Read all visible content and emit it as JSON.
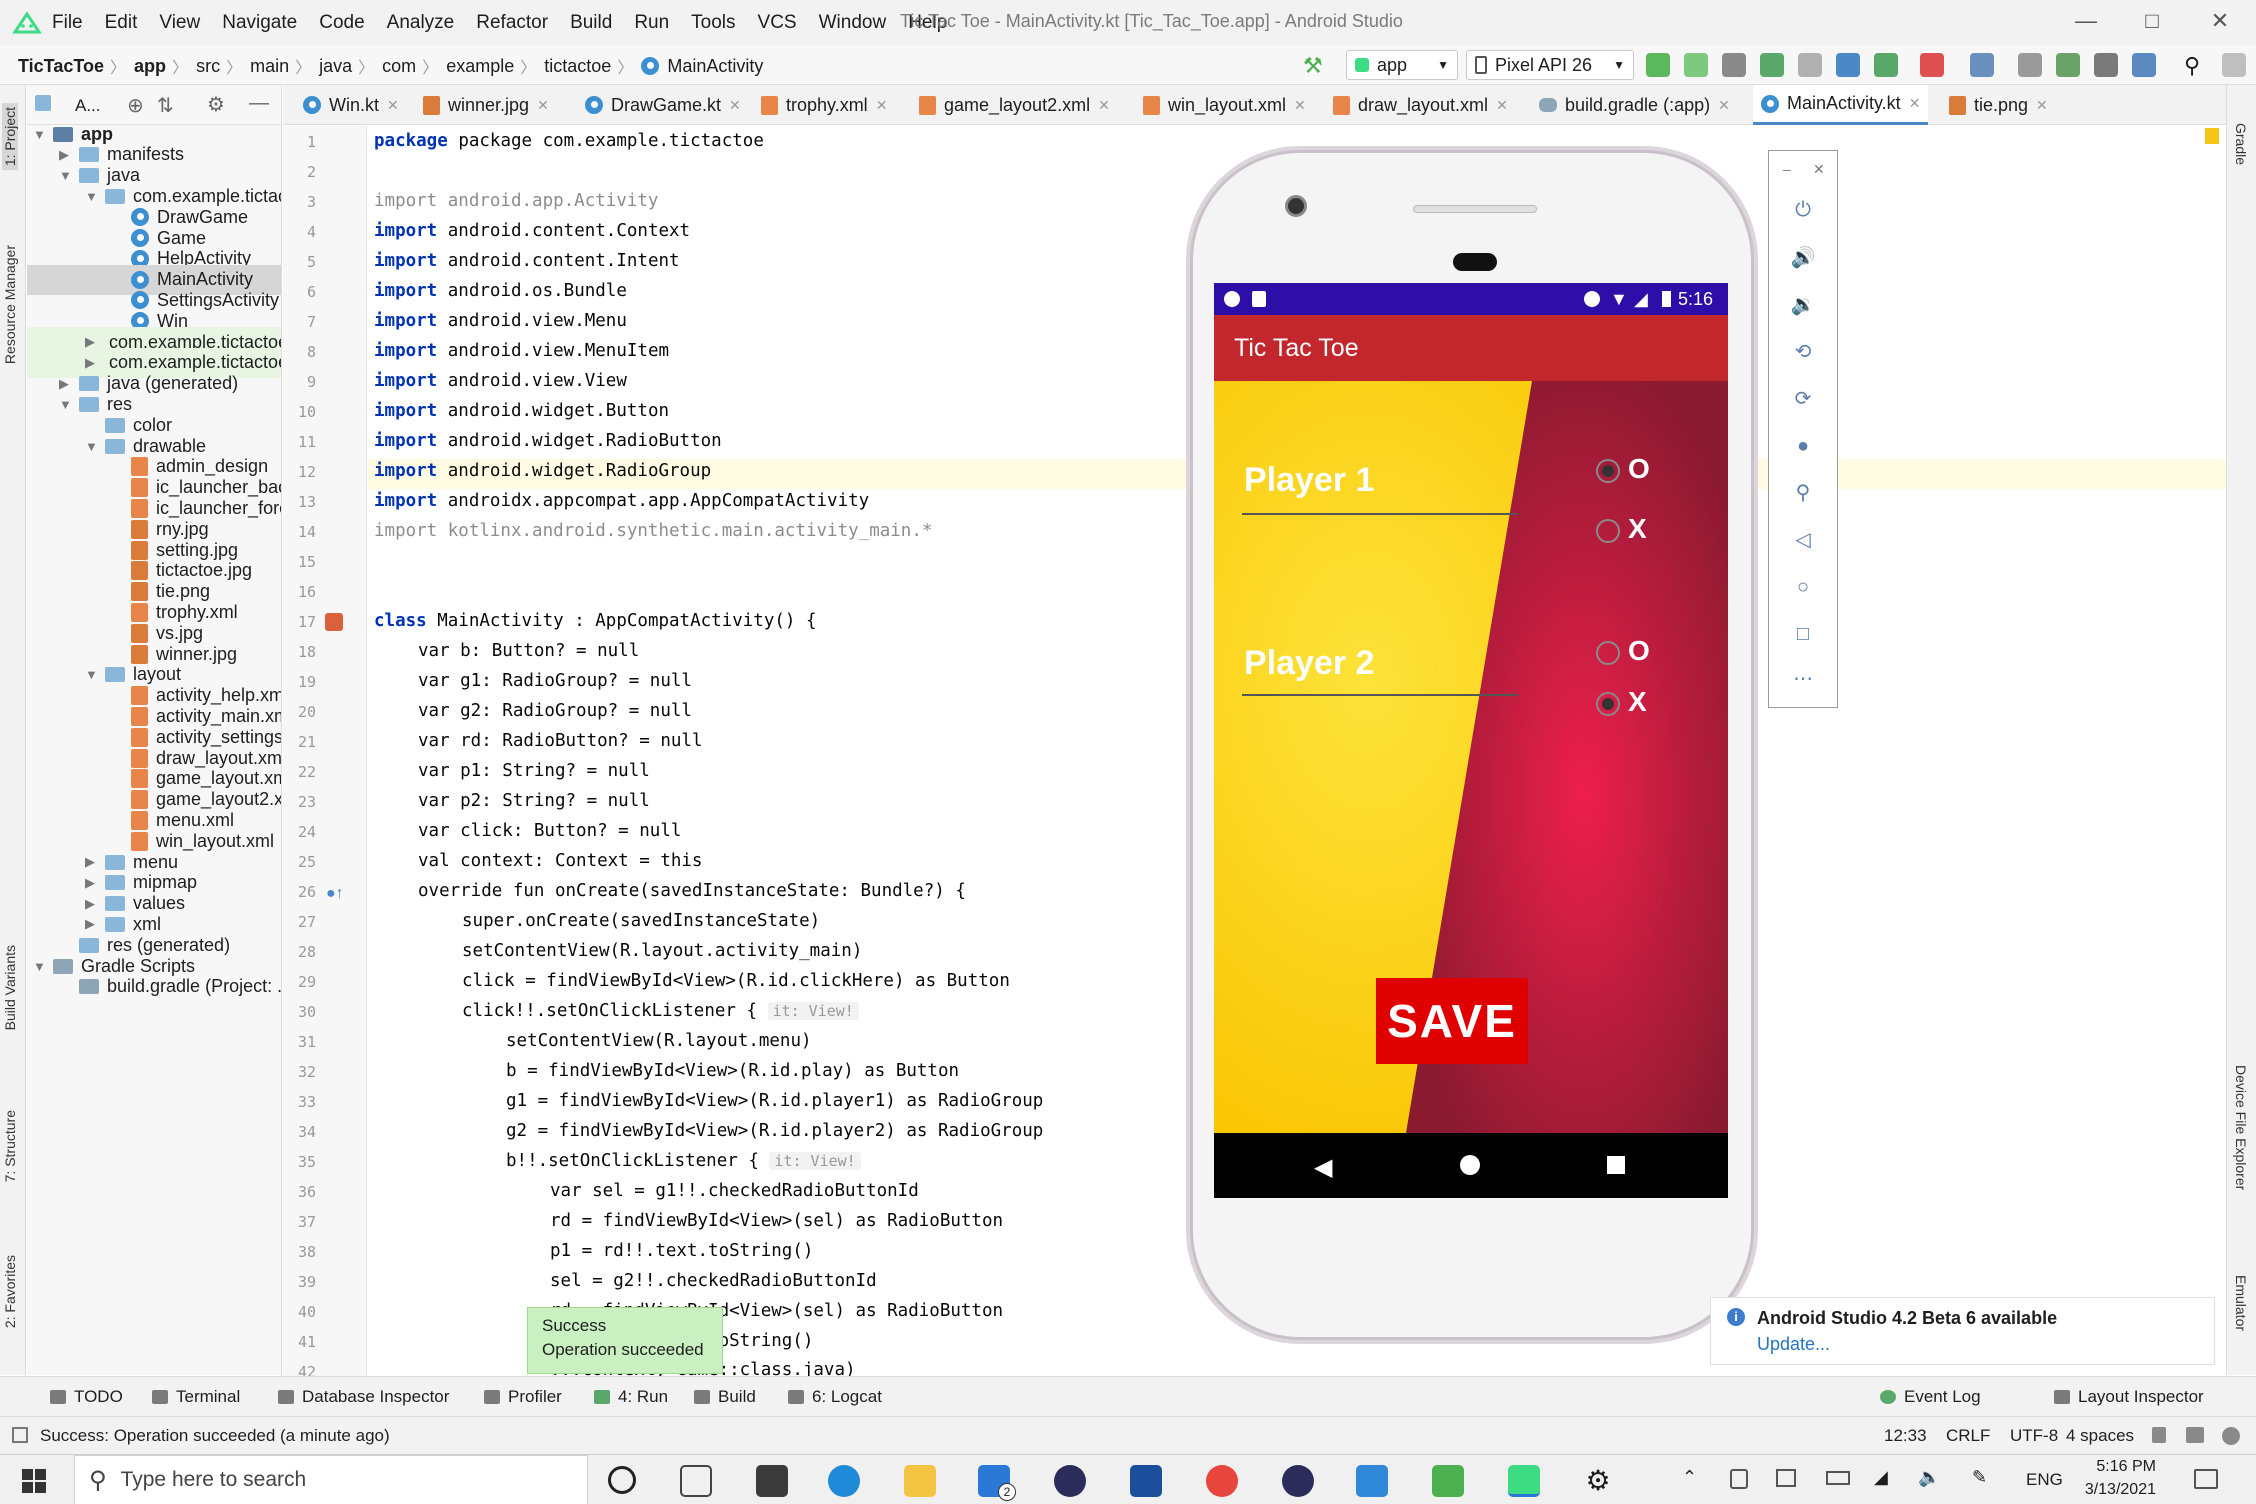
{
  "window": {
    "title": "Tic Tac Toe - MainActivity.kt [Tic_Tac_Toe.app] - Android Studio",
    "menu": [
      "File",
      "Edit",
      "View",
      "Navigate",
      "Code",
      "Analyze",
      "Refactor",
      "Build",
      "Run",
      "Tools",
      "VCS",
      "Window",
      "Help"
    ]
  },
  "breadcrumb": [
    "TicTacToe",
    "app",
    "src",
    "main",
    "java",
    "com",
    "example",
    "tictactoe",
    "MainActivity"
  ],
  "toolbar": {
    "run_config": "app",
    "device": "Pixel API 26"
  },
  "left_strip": {
    "project": "1: Project",
    "resource_manager": "Resource Manager",
    "build_variants": "Build Variants",
    "structure": "7: Structure",
    "favorites": "2: Favorites"
  },
  "right_strip": {
    "gradle": "Gradle",
    "device_file_explorer": "Device File Explorer",
    "emulator": "Emulator"
  },
  "project_panel": {
    "view_label": "A...",
    "tree": [
      {
        "label": "app",
        "bold": true
      },
      {
        "label": "manifests"
      },
      {
        "label": "java"
      },
      {
        "label": "com.example.tictactoe"
      },
      {
        "label": "DrawGame"
      },
      {
        "label": "Game"
      },
      {
        "label": "HelpActivity"
      },
      {
        "label": "MainActivity"
      },
      {
        "label": "SettingsActivity"
      },
      {
        "label": "Win"
      },
      {
        "label": "com.example.tictactoe"
      },
      {
        "label": "com.example.tictactoe"
      },
      {
        "label": "java (generated)"
      },
      {
        "label": "res"
      },
      {
        "label": "color"
      },
      {
        "label": "drawable"
      },
      {
        "label": "admin_design"
      },
      {
        "label": "ic_launcher_background"
      },
      {
        "label": "ic_launcher_foreground"
      },
      {
        "label": "rny.jpg"
      },
      {
        "label": "setting.jpg"
      },
      {
        "label": "tictactoe.jpg"
      },
      {
        "label": "tie.png"
      },
      {
        "label": "trophy.xml"
      },
      {
        "label": "vs.jpg"
      },
      {
        "label": "winner.jpg"
      },
      {
        "label": "layout"
      },
      {
        "label": "activity_help.xml"
      },
      {
        "label": "activity_main.xml"
      },
      {
        "label": "activity_settings.xml"
      },
      {
        "label": "draw_layout.xml"
      },
      {
        "label": "game_layout.xml"
      },
      {
        "label": "game_layout2.xml"
      },
      {
        "label": "menu.xml"
      },
      {
        "label": "win_layout.xml"
      },
      {
        "label": "menu"
      },
      {
        "label": "mipmap"
      },
      {
        "label": "values"
      },
      {
        "label": "xml"
      },
      {
        "label": "res (generated)"
      },
      {
        "label": "Gradle Scripts"
      },
      {
        "label": "build.gradle (Project: ...)"
      }
    ]
  },
  "editor_tabs": [
    "Win.kt",
    "winner.jpg",
    "DrawGame.kt",
    "trophy.xml",
    "game_layout2.xml",
    "win_layout.xml",
    "draw_layout.xml",
    "build.gradle (:app)",
    "MainActivity.kt",
    "tie.png"
  ],
  "active_tab": "MainActivity.kt",
  "line_numbers": [
    "1",
    "2",
    "3",
    "4",
    "5",
    "6",
    "7",
    "8",
    "9",
    "10",
    "11",
    "12",
    "13",
    "14",
    "15",
    "16",
    "17",
    "18",
    "19",
    "20",
    "21",
    "22",
    "23",
    "24",
    "25",
    "26",
    "27",
    "28",
    "29",
    "30",
    "31",
    "32",
    "33",
    "34",
    "35",
    "36",
    "37",
    "38",
    "39",
    "40",
    "41",
    "42"
  ],
  "code": {
    "l1": "package com.example.tictactoe",
    "l3a": "import",
    "l3b": " android.app.Activity",
    "l4": "android.content.Context",
    "l5": "android.content.Intent",
    "l6": "android.os.Bundle",
    "l7": "android.view.Menu",
    "l8": "android.view.MenuItem",
    "l9": "android.view.View",
    "l10": "android.widget.Button",
    "l11": "android.widget.RadioButton",
    "l12": "android.widget.RadioGroup",
    "l13": "androidx.appcompat.app.AppCompatActivity",
    "l14": " kotlinx.android.synthetic.main.activity_main.*",
    "kw_import": "import",
    "l17": "MainActivity : AppCompatActivity() {",
    "kw_class": "class",
    "l18": "var b: Button? = null",
    "l19": "var g1: RadioGroup? = null",
    "l20": "var g2: RadioGroup? = null",
    "l21": "var rd: RadioButton? = null",
    "l22": "var p1: String? = null",
    "l23": "var p2: String? = null",
    "l24": "var click: Button? = null",
    "l25": "val context: Context = this",
    "l26": "override fun onCreate(savedInstanceState: Bundle?) {",
    "l27": "super.onCreate(savedInstanceState)",
    "l28": "setContentView(R.layout.activity_main)",
    "l29": "click = findViewById<View>(R.id.clickHere) as Button",
    "l30": "click!!.setOnClickListener {",
    "l31": "setContentView(R.layout.menu)",
    "l32": "b = findViewById<View>(R.id.play) as Button",
    "l33": "g1 = findViewById<View>(R.id.player1) as RadioGroup",
    "l34": "g2 = findViewById<View>(R.id.player2) as RadioGroup",
    "l35": "b!!.setOnClickListener {",
    "l36": "var sel = g1!!.checkedRadioButtonId",
    "l37": "rd = findViewById<View>(sel) as RadioButton",
    "l38": "p1 = rd!!.text.toString()",
    "l39": "sel = g2!!.checkedRadioButtonId",
    "l40": "rd = findViewById<View>(sel) as RadioButton",
    "l41": "p2 = rd!!.text.toString()",
    "l42": "...context, Game::class.java)",
    "hint": "it: View!"
  },
  "emulator": {
    "time": "5:16",
    "app_title": "Tic Tac Toe",
    "player1": "Player 1",
    "player2": "Player 2",
    "opt_o": "O",
    "opt_x": "X",
    "save": "SAVE",
    "p1_selected": "O",
    "p2_selected": "X"
  },
  "toast": {
    "title": "Success",
    "body": "Operation succeeded"
  },
  "notification": {
    "title": "Android Studio 4.2 Beta 6 available",
    "link": "Update..."
  },
  "bottom_tools": [
    "TODO",
    "Terminal",
    "Database Inspector",
    "Profiler",
    "4: Run",
    "Build",
    "6: Logcat",
    "Event Log",
    "Layout Inspector"
  ],
  "status": {
    "message": "Success: Operation succeeded (a minute ago)",
    "position": "12:33",
    "line_sep": "CRLF",
    "encoding": "UTF-8",
    "indent": "4 spaces"
  },
  "taskbar": {
    "search_placeholder": "Type here to search",
    "lang": "ENG",
    "time": "5:16 PM",
    "date": "3/13/2021",
    "mail_badge": "2"
  },
  "colors": {
    "statusbar": "#2d0ea8",
    "appbar": "#c1272d",
    "save": "#e10000",
    "accent": "#4a88c7"
  }
}
